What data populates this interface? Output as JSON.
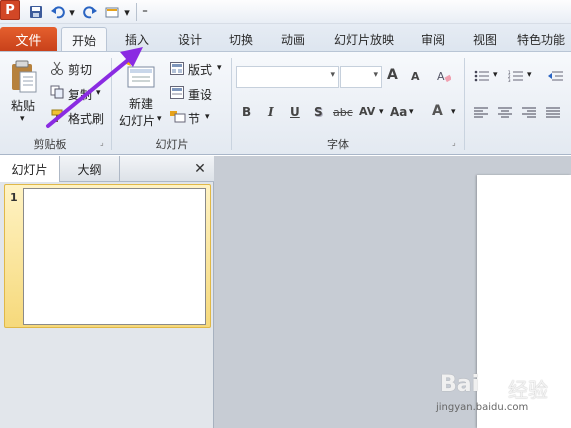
{
  "window": {
    "app_logo": "P"
  },
  "qat": {
    "customize_glyph": "▾",
    "more_glyph": "⁼"
  },
  "tabs": [
    {
      "id": "file",
      "label": "文件"
    },
    {
      "id": "home",
      "label": "开始"
    },
    {
      "id": "insert",
      "label": "插入"
    },
    {
      "id": "design",
      "label": "设计"
    },
    {
      "id": "transitions",
      "label": "切换"
    },
    {
      "id": "animations",
      "label": "动画"
    },
    {
      "id": "slideshow",
      "label": "幻灯片放映"
    },
    {
      "id": "review",
      "label": "审阅"
    },
    {
      "id": "view",
      "label": "视图"
    },
    {
      "id": "special",
      "label": "特色功能"
    }
  ],
  "ribbon": {
    "clipboard": {
      "paste": "粘贴",
      "cut": "剪切",
      "copy": "复制",
      "format_painter": "格式刷",
      "group_label": "剪贴板"
    },
    "slides": {
      "new_slide_line1": "新建",
      "new_slide_line2": "幻灯片",
      "layout": "版式",
      "reset": "重设",
      "section": "节",
      "group_label": "幻灯片"
    },
    "font": {
      "font_name": "",
      "font_size": "",
      "bold": "B",
      "italic": "I",
      "underline": "U",
      "shadow": "S",
      "strike": "abc",
      "spacing": "AV",
      "case": "Aa",
      "color": "A",
      "grow": "A",
      "shrink": "A",
      "group_label": "字体"
    }
  },
  "panel": {
    "tab_slides": "幻灯片",
    "tab_outline": "大纲",
    "close_glyph": "✕",
    "slide_number": "1"
  },
  "watermark": {
    "logo": "Bai",
    "logo_suffix": "经验",
    "url": "jingyan.baidu.com"
  },
  "colors": {
    "accent": "#c7401a",
    "arrow": "#8a2be2",
    "selected_slide": "#f6d97b"
  }
}
